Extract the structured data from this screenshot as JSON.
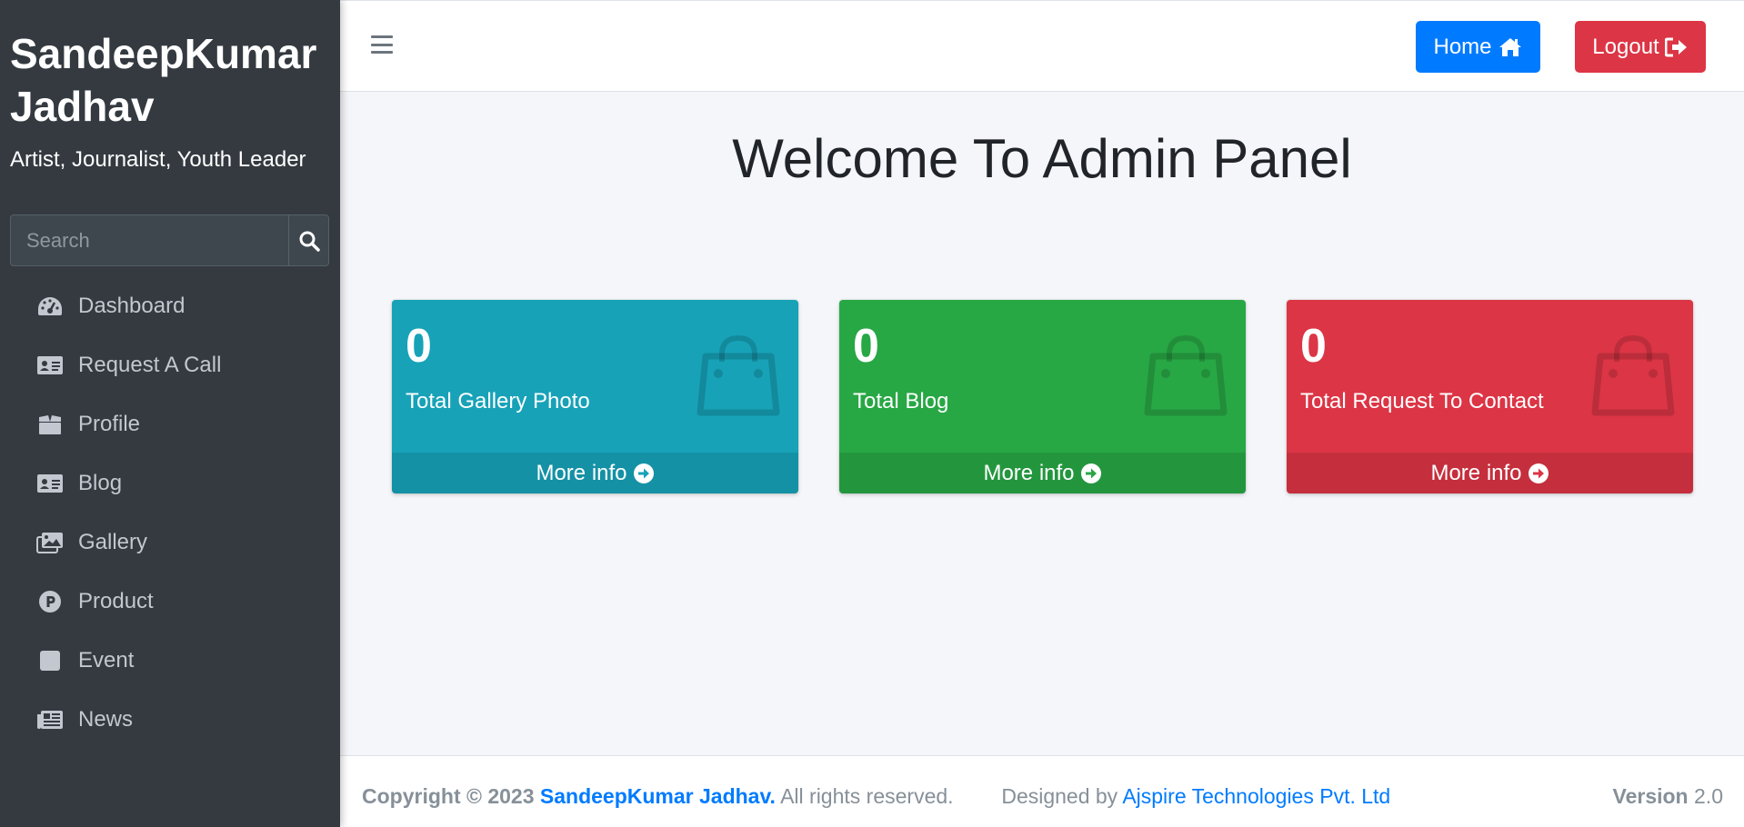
{
  "sidebar": {
    "brand_name": "SandeepKumar Jadhav",
    "tagline": "Artist, Journalist, Youth Leader",
    "search": {
      "placeholder": "Search",
      "value": ""
    },
    "items": [
      {
        "label": "Dashboard",
        "icon": "tachometer-icon"
      },
      {
        "label": "Request A Call",
        "icon": "id-card-icon"
      },
      {
        "label": "Profile",
        "icon": "box-open-icon"
      },
      {
        "label": "Blog",
        "icon": "id-card-icon"
      },
      {
        "label": "Gallery",
        "icon": "images-icon"
      },
      {
        "label": "Product",
        "icon": "product-p-icon"
      },
      {
        "label": "Event",
        "icon": "square-icon"
      },
      {
        "label": "News",
        "icon": "newspaper-icon"
      }
    ]
  },
  "header": {
    "home_label": "Home",
    "logout_label": "Logout"
  },
  "main": {
    "title": "Welcome To Admin Panel",
    "cards": [
      {
        "count": "0",
        "label": "Total Gallery Photo",
        "more": "More info",
        "color": "#17a2b8"
      },
      {
        "count": "0",
        "label": "Total Blog",
        "more": "More info",
        "color": "#28a745"
      },
      {
        "count": "0",
        "label": "Total Request To Contact",
        "more": "More info",
        "color": "#dc3545"
      }
    ]
  },
  "footer": {
    "copyright_prefix": "Copyright © 2023",
    "owner": "SandeepKumar Jadhav.",
    "rights": "All rights reserved.",
    "designed_by": "Designed by",
    "company": "Ajspire Technologies Pvt. Ltd",
    "version_label": "Version",
    "version_value": "2.0"
  },
  "colors": {
    "sidebar_bg": "#343a40",
    "primary": "#007bff",
    "danger": "#dc3545",
    "info": "#17a2b8",
    "success": "#28a745"
  }
}
